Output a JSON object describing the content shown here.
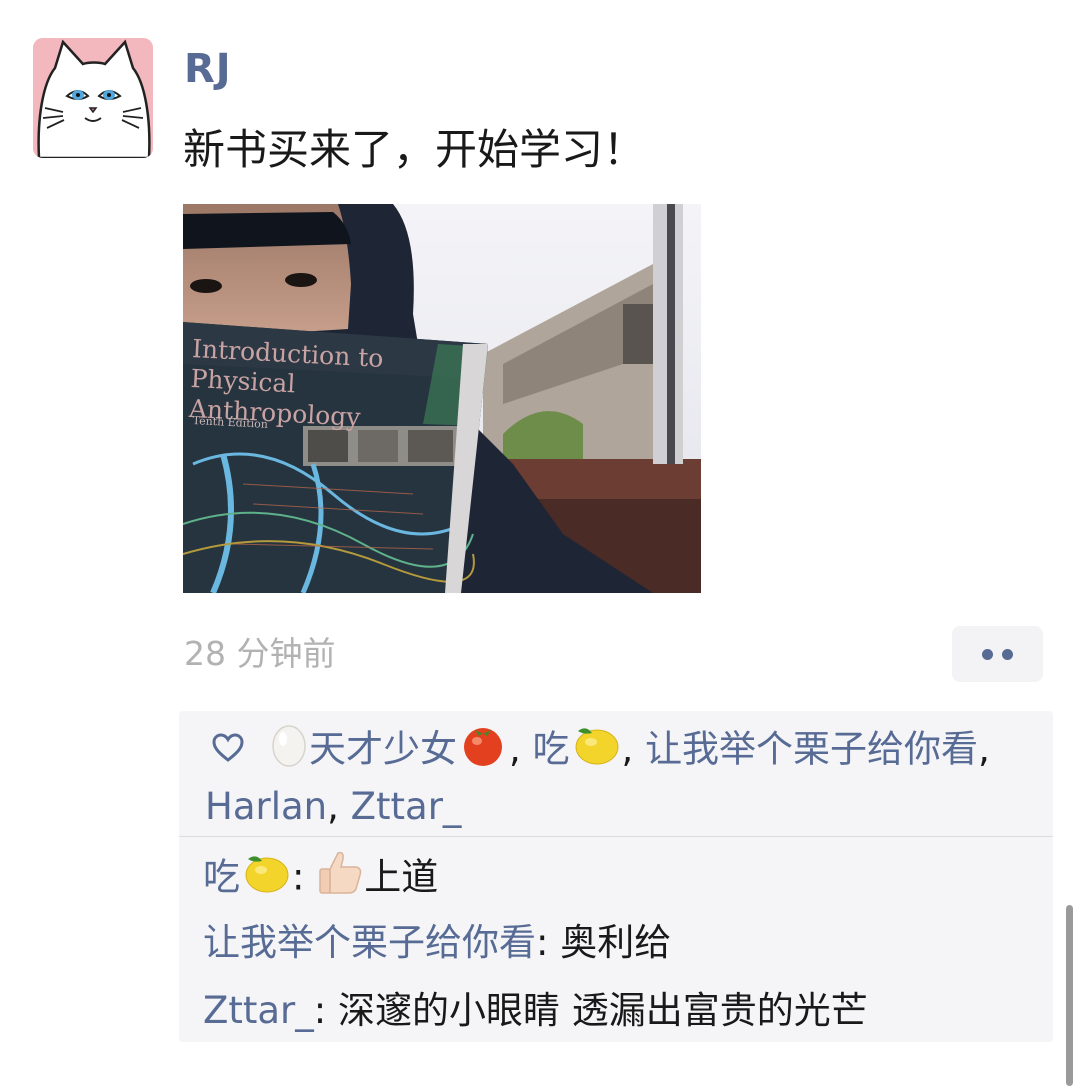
{
  "post": {
    "username": "RJ",
    "text": "新书买来了，开始学习！",
    "timestamp": "28 分钟前",
    "photo": {
      "book_title": "Introduction to Physical Anthropology",
      "book_edition": "Tenth Edition"
    }
  },
  "likes": {
    "names": [
      "天才少女",
      "吃",
      "让我举个栗子给你看",
      "Harlan",
      "Zttar_"
    ],
    "separator": ","
  },
  "comments": [
    {
      "author": "吃",
      "text": "上道"
    },
    {
      "author": "让我举个栗子给你看",
      "text": "奥利给"
    },
    {
      "author": "Zttar_",
      "text": "深邃的小眼睛 透漏出富贵的光芒"
    }
  ],
  "colors": {
    "link": "#576b95",
    "text": "#191919",
    "timestamp": "#b2b2b2",
    "comment_bg": "#f5f5f7"
  },
  "icons": [
    "cat-avatar-icon",
    "heart-outline-icon",
    "more-dots-icon",
    "egg-emoji",
    "tomato-emoji",
    "lemon-emoji",
    "thumbs-up-emoji"
  ]
}
